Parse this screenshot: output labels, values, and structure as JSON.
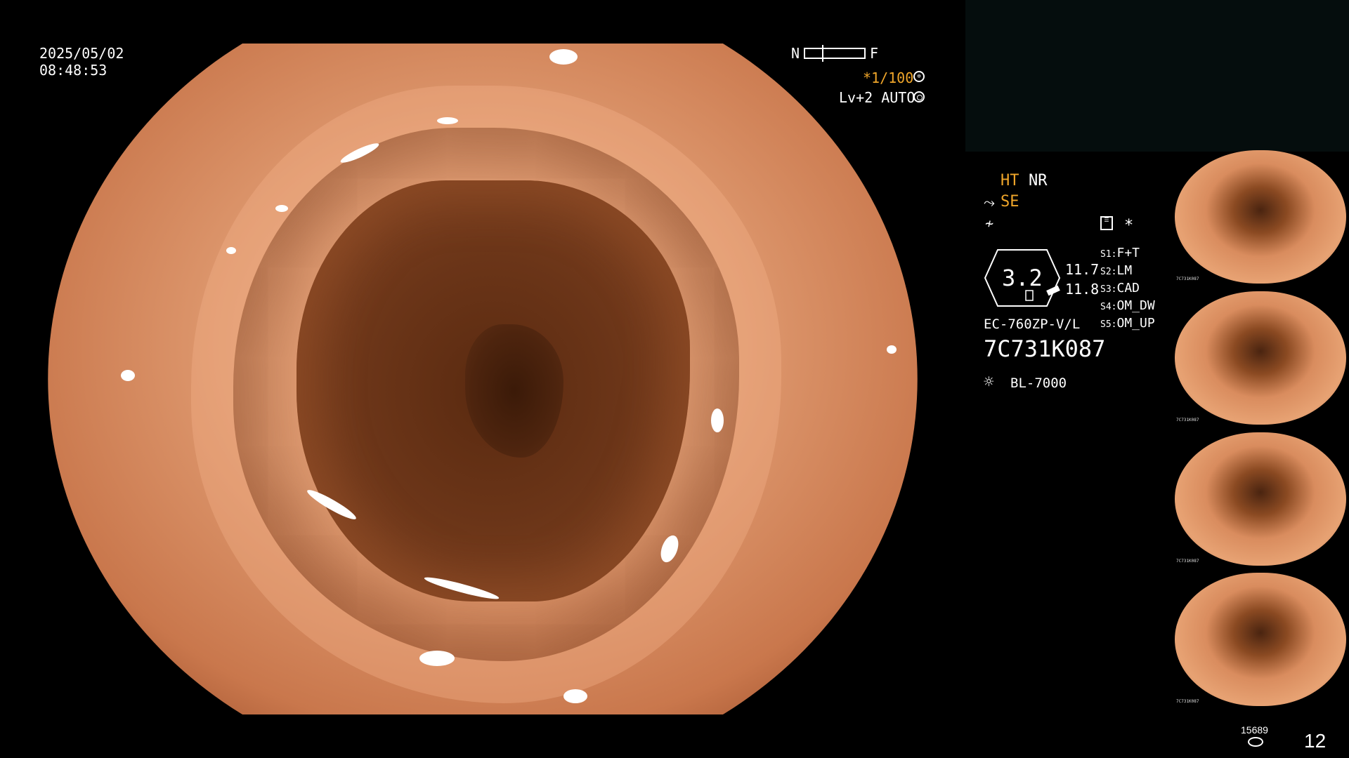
{
  "osd": {
    "date": "2025/05/02",
    "time": "08:48:53",
    "nf_left": "N",
    "nf_right": "F",
    "shutter": "*1/100",
    "level": "Lv+2 AUTO"
  },
  "settings": {
    "ht": "HT",
    "nr": "NR",
    "se": "SE",
    "light_value": "3.2",
    "range_top": "11.7",
    "range_bottom": "11.8",
    "scope_model": "EC-760ZP-V/L",
    "serial": "7C731K087",
    "light_source": "BL-7000",
    "asterisk": "*"
  },
  "switches": [
    {
      "key": "S1",
      "value": "F+T"
    },
    {
      "key": "S2",
      "value": "LM"
    },
    {
      "key": "S3",
      "value": "CAD"
    },
    {
      "key": "S4",
      "value": "OM_DW"
    },
    {
      "key": "S5",
      "value": "OM_UP"
    }
  ],
  "thumb_label": "7C731K087",
  "footer": {
    "storage_count": "15689",
    "capture_count": "12"
  }
}
